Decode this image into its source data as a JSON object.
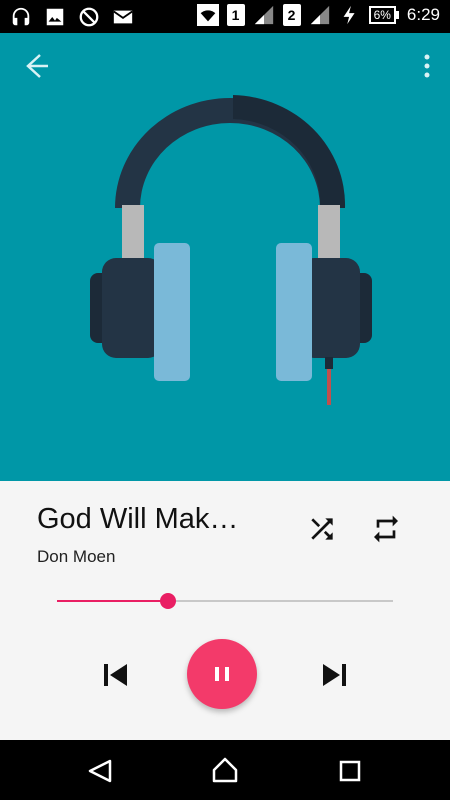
{
  "status_bar": {
    "icons_left": [
      "headphones-icon",
      "image-icon",
      "sync-disabled-icon",
      "mail-icon"
    ],
    "icons_right": [
      "wifi-icon",
      "sim-1",
      "signal-icon",
      "sim-2",
      "signal-icon",
      "charging-icon"
    ],
    "sim1_label": "1",
    "sim2_label": "2",
    "battery_label": "6%",
    "time": "6:29"
  },
  "toolbar": {
    "back_icon": "arrow-back-icon",
    "more_icon": "more-vert-icon"
  },
  "colors": {
    "album_bg": "#0097A7",
    "accent": "#E91E63",
    "play_button": "#F33A6A",
    "panel_bg": "#F5F5F5"
  },
  "track": {
    "title": "God Will Mak…",
    "artist": "Don Moen",
    "progress": 0.33
  },
  "controls": {
    "shuffle_icon": "shuffle-icon",
    "repeat_icon": "repeat-icon",
    "prev_icon": "skip-previous-icon",
    "play_state_icon": "pause-icon",
    "next_icon": "skip-next-icon"
  },
  "nav_bar": {
    "back_icon": "nav-back-icon",
    "home_icon": "nav-home-icon",
    "recent_icon": "nav-recents-icon"
  }
}
